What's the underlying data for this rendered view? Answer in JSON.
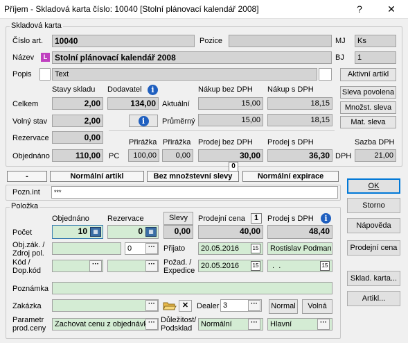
{
  "window": {
    "title": "Příjem - Skladová karta číslo: 10040 [Stolní plánovací kalendář 2008]",
    "help": "?",
    "close": "✕"
  },
  "card": {
    "group_title": "Skladová karta",
    "cislo_art_label": "Číslo art.",
    "cislo_art_value": "10040",
    "pozice_label": "Pozice",
    "pozice_value": "",
    "mj_label": "MJ",
    "mj_value": "Ks",
    "nazev_label": "Název",
    "nazev_value": "Stolní plánovací kalendář 2008",
    "lang_badge": "L",
    "bj_label": "BJ",
    "bj_value": "1",
    "popis_label": "Popis",
    "popis_value": "Text",
    "aktivni_btn": "Aktivní artikl",
    "stavy_label": "Stavy skladu",
    "dodavatel_label": "Dodavatel",
    "nakup_bez_label": "Nákup bez DPH",
    "nakup_s_label": "Nákup s DPH",
    "sleva_povolena_btn": "Sleva povolena",
    "celkem_label": "Celkem",
    "celkem_value": "2,00",
    "dodavatel_value": "134,00",
    "aktualni_label": "Aktuální",
    "aktualni_bez": "15,00",
    "aktualni_s": "18,15",
    "mnozst_sleva_btn": "Množst. sleva",
    "volny_label": "Volný stav",
    "volny_value": "2,00",
    "prumerny_label": "Průměrný",
    "prumerny_bez": "15,00",
    "prumerny_s": "18,15",
    "mat_sleva_btn": "Mat. sleva",
    "rezervace_label": "Rezervace",
    "rezervace_value": "0,00",
    "prirazka1_label": "Přirážka",
    "prirazka2_label": "Přirážka",
    "prodej_bez_label": "Prodej bez DPH",
    "prodej_s_label": "Prodej s DPH",
    "sazba_label": "Sazba DPH",
    "objednano_label": "Objednáno",
    "objednano_value": "110,00",
    "pc_label": "PC",
    "prirazka1_value": "100,00",
    "prirazka2_value": "0,00",
    "prodej_bez_value": "30,00",
    "prodej_s_value": "36,30",
    "dph_label": "DPH",
    "sazba_value": "21,00"
  },
  "statusbar": {
    "dash": "-",
    "normal_artikl": "Normální artikl",
    "bez_slevy": "Bez množstevní slevy",
    "count": "0",
    "normal_expirace": "Normální expirace"
  },
  "pozn": {
    "label": "Pozn.int",
    "value": "***"
  },
  "polozka": {
    "group_title": "Položka",
    "objednano_label": "Objednáno",
    "rezervace_label": "Rezervace",
    "slevy_btn": "Slevy",
    "prodejni_cena_label": "Prodejní cena",
    "prodejni_badge": "1",
    "prodej_s_label": "Prodej s DPH",
    "pocet_label": "Počet",
    "pocet_value": "10",
    "rezervace_value": "0",
    "sleva_value": "0,00",
    "prodejni_cena_value": "40,00",
    "prodej_s_value": "48,40",
    "obj_zak_label": "Obj.zák. /\nZdroj pol.",
    "zdroj_value": "0",
    "prijato_label": "Přijato",
    "prijato_value": "20.05.2016",
    "osoba_value": "Rostislav Podmanick",
    "kod_label": "Kód /\nDop.kód",
    "pozad_label": "Požad. /\nExpedice",
    "pozad_value": "20.05.2016",
    "expedice_value": " .  .",
    "poznamka_label": "Poznámka",
    "zakazka_label": "Zakázka",
    "dealer_label": "Dealer",
    "dealer_value": "3",
    "normal_btn": "Normal",
    "volna_btn": "Volná",
    "parametr_label": "Parametr\nprod.ceny",
    "parametr_value": "Zachovat cenu z objednávky",
    "dulezitost_label": "Důležitost/\nPodsklad",
    "dulezitost_value": "Normální",
    "podsklad_value": "Hlavní"
  },
  "buttons": {
    "ok": "OK",
    "storno": "Storno",
    "napoveda": "Nápověda",
    "prodejni_cena": "Prodejní cena",
    "sklad_karta": "Sklad. karta...",
    "artikl": "Artikl..."
  }
}
